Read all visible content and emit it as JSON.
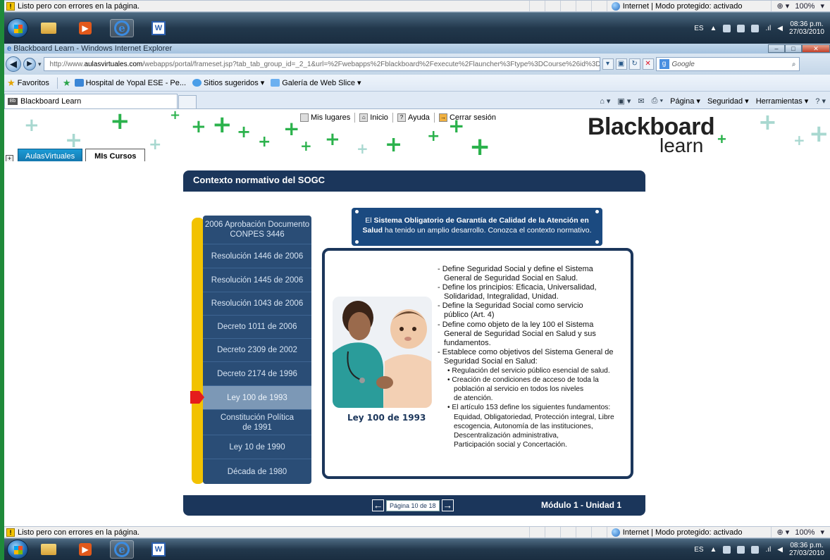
{
  "status_bar": {
    "message": "Listo pero con errores en la página.",
    "zone": "Internet | Modo protegido: activado",
    "zoom": "100%"
  },
  "taskbar": {
    "language": "ES",
    "time": "08:36 p.m.",
    "date": "27/03/2010"
  },
  "window": {
    "title": "Blackboard Learn - Windows Internet Explorer"
  },
  "address_bar": {
    "url_prefix": "http://www.",
    "url_domain": "aulasvirtuales.com",
    "url_rest": "/webapps/portal/frameset.jsp?tab_tab_group_id=_2_1&url=%2Fwebapps%2Fblackboard%2Fexecute%2Flauncher%3Ftype%3DCourse%26id%3D_1(",
    "search_placeholder": "Google"
  },
  "favorites_bar": {
    "label": "Favoritos",
    "items": [
      "Hospital de Yopal ESE - Pe...",
      "Sitios sugeridos",
      "Galería de Web Slice"
    ]
  },
  "tab": {
    "title": "Blackboard Learn"
  },
  "command_bar": {
    "items": [
      "Página",
      "Seguridad",
      "Herramientas"
    ]
  },
  "banner": {
    "links": [
      "Mis lugares",
      "Inicio",
      "Ayuda",
      "Cerrar sesión"
    ],
    "logo_top": "Blackboard",
    "logo_bottom": "learn",
    "course_tabs": [
      "AulasVirtuales",
      "MIs Cursos"
    ]
  },
  "lesson": {
    "header": "Contexto normativo del SOGC",
    "timeline": [
      "2006 Aprobación Documento CONPES 3446",
      "Resolución 1446 de 2006",
      "Resolución 1445 de 2006",
      "Resolución 1043 de 2006",
      "Decreto 1011 de 2006",
      "Decreto 2309 de 2002",
      "Decreto 2174 de 1996",
      "Ley 100 de 1993",
      "Constitución Política de 1991",
      "Ley 10 de 1990",
      "Década de 1980"
    ],
    "active_index": 7,
    "callout_bold1": "Sistema Obligatorio de Garantía de Calidad de la Atención en",
    "callout_pre": "El ",
    "callout_bold2": "Salud",
    "callout_post": " ha tenido un amplio desarrollo. Conozca el contexto normativo.",
    "photo_caption": "Ley 100 de 1993",
    "description_lines": [
      "- Define Seguridad Social y define el Sistema",
      "  General de Seguridad Social en Salud.",
      "- Define los principios: Eficacia, Universalidad,",
      "  Solidaridad, Integralidad, Unidad.",
      "- Define la Seguridad Social como servicio",
      "  público (Art. 4)",
      "- Define como objeto de la ley 100 el Sistema",
      "  General de Seguridad Social en Salud y sus",
      "  fundamentos.",
      "- Establece como objetivos del Sistema General de",
      "  Seguridad Social en Salud:"
    ],
    "sub_lines": [
      "• Regulación del servicio público esencial de salud.",
      "• Creación de condiciones de acceso de toda la",
      "  población al servicio en todos los niveles",
      "  de atención.",
      "• El artículo 153  define los siguientes fundamentos:",
      "  Equidad, Obligatoriedad, Protección integral, Libre",
      "  escogencia, Autonomía de las instituciones,",
      "  Descentralización administrativa,",
      "  Participación social y Concertación."
    ],
    "page_label": "Página 10 de 18",
    "module_label": "Módulo 1 - Unidad 1"
  },
  "colors": {
    "navy": "#1b365b",
    "timeline_bg": "#2a4d76",
    "timeline_active": "#7c98b6",
    "accent_yellow": "#f2c200",
    "pointer_red": "#e51c1c",
    "brand_green": "#2bb24c"
  }
}
